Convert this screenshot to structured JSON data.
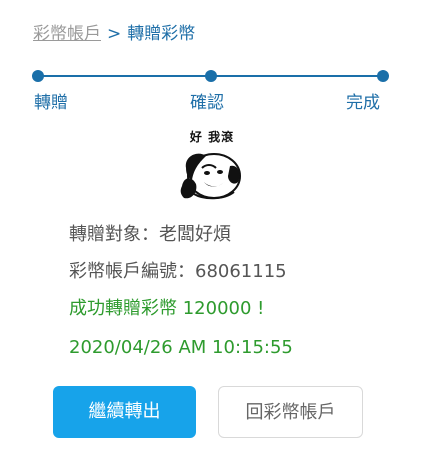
{
  "breadcrumb": {
    "parent": "彩幣帳戶",
    "separator": ">",
    "current": "轉贈彩幣"
  },
  "stepper": {
    "steps": [
      {
        "label": "轉贈"
      },
      {
        "label": "確認"
      },
      {
        "label": "完成"
      }
    ],
    "color": "#1a6fa9"
  },
  "sticker": {
    "caption": "好 我滾",
    "icon": "panda-meme-face"
  },
  "result": {
    "recipient_label": "轉贈對象",
    "recipient_value": "老闆好煩",
    "recipient_text": "轉贈對象：老闆好煩",
    "account_text": "彩幣帳戶編號：68061115",
    "success_text": "成功轉贈彩幣 120000 !",
    "datetime_text": "2020/04/26 AM 10:15:55",
    "success_color": "#2e9b2e"
  },
  "actions": {
    "continue_label": "繼續轉出",
    "back_label": "回彩幣帳戶",
    "primary_color": "#17a3ea"
  }
}
